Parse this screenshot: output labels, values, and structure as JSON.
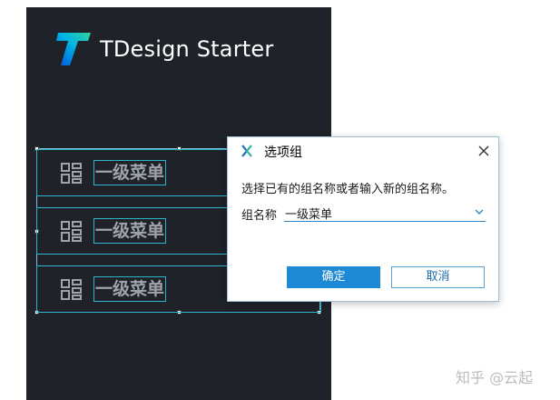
{
  "app": {
    "title": "TDesign Starter"
  },
  "menu": {
    "items": [
      {
        "label": "一级菜单",
        "icon": "grid-icon"
      },
      {
        "label": "一级菜单",
        "icon": "grid-icon"
      },
      {
        "label": "一级菜单",
        "icon": "grid-icon"
      }
    ]
  },
  "dialog": {
    "title": "选项组",
    "prompt": "选择已有的组名称或者输入新的组名称。",
    "field_label": "组名称",
    "field_value": "一级菜单",
    "ok_label": "确定",
    "cancel_label": "取消"
  },
  "watermark": "知乎 @云起",
  "colors": {
    "sidebar_bg": "#1f2229",
    "selection": "#2db4c7",
    "primary": "#1e8ad5",
    "logo_start": "#0052d9",
    "logo_end": "#2fd2a0"
  }
}
